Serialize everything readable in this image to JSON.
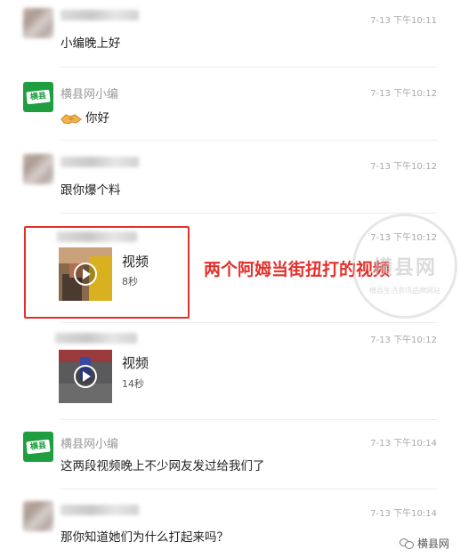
{
  "messages": [
    {
      "sender": "",
      "time": "7-13 下午10:11",
      "text": "小编晚上好"
    },
    {
      "sender": "横县网小编",
      "time": "7-13 下午10:12",
      "text": "你好",
      "emoji": "handshake-emoji"
    },
    {
      "sender": "",
      "time": "7-13 下午10:12",
      "text": "跟你爆个料"
    },
    {
      "sender": "",
      "time": "7-13 下午10:12",
      "video": {
        "label": "视频",
        "duration": "8秒"
      }
    },
    {
      "sender": "",
      "time": "7-13 下午10:12",
      "video": {
        "label": "视频",
        "duration": "14秒"
      }
    },
    {
      "sender": "横县网小编",
      "time": "7-13 下午10:14",
      "text": "这两段视频晚上不少网友发过给我们了"
    },
    {
      "sender": "",
      "time": "7-13 下午10:14",
      "text": "那你知道她们为什么打起来吗？"
    }
  ],
  "brand_avatar_text": "横县网",
  "annotation": "两个阿姆当街扭打的视频",
  "watermark": {
    "main": "横县网",
    "sub": "横县生活资讯品牌网站"
  },
  "footer": {
    "account": "横县网",
    "icon": "wechat-icon"
  },
  "colors": {
    "accent_red": "#e4302b",
    "brand_green": "#1e9e3f"
  }
}
